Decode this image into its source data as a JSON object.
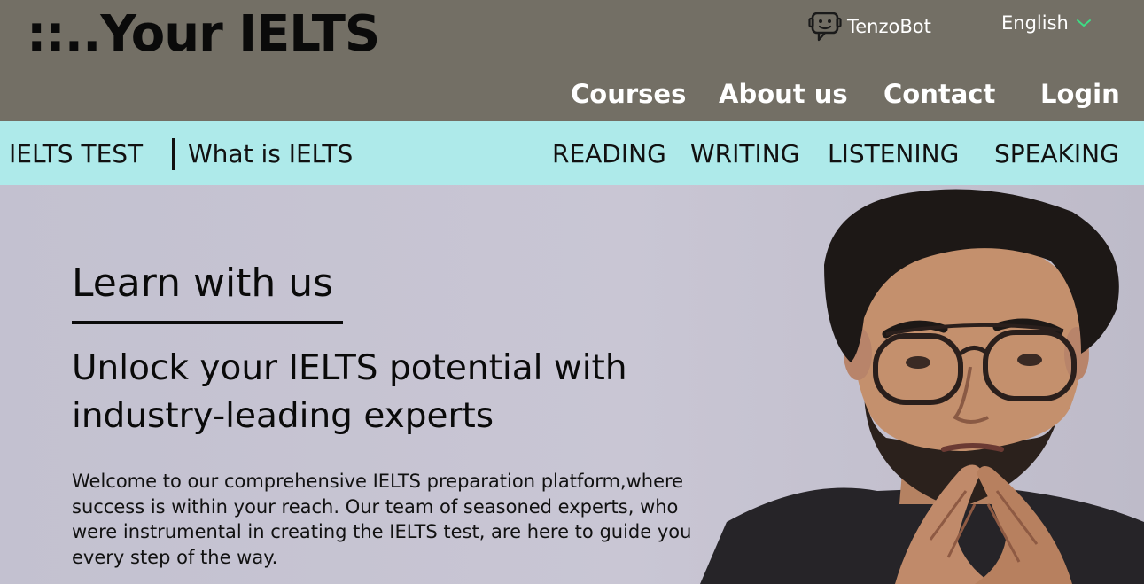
{
  "header": {
    "logo": "::..Your IELTS",
    "bot_label": "TenzoBot",
    "bot_icon": "chatbot-icon",
    "language": "English",
    "language_icon": "chevron-down-icon",
    "nav": [
      "Courses",
      "About us",
      "Contact",
      "Login"
    ]
  },
  "subnav": {
    "test_label": "IELTS TEST",
    "what_label": "What is IELTS",
    "modules": [
      "READING",
      "WRITING",
      "LISTENING",
      "SPEAKING"
    ]
  },
  "hero": {
    "title": "Learn with us",
    "subtitle": "Unlock your IELTS potential with industry-leading experts",
    "body": "Welcome to our comprehensive IELTS preparation platform,where success is within your reach. Our team of seasoned experts, who were instrumental in creating the IELTS test, are here to guide you every step of the way."
  },
  "colors": {
    "header_bg": "#736f65",
    "subnav_bg": "#aeeaea",
    "hero_bg": "#c4c1cf",
    "accent_green": "#3ddc84",
    "text_dark": "#0a0a0a",
    "text_light": "#ffffff"
  }
}
